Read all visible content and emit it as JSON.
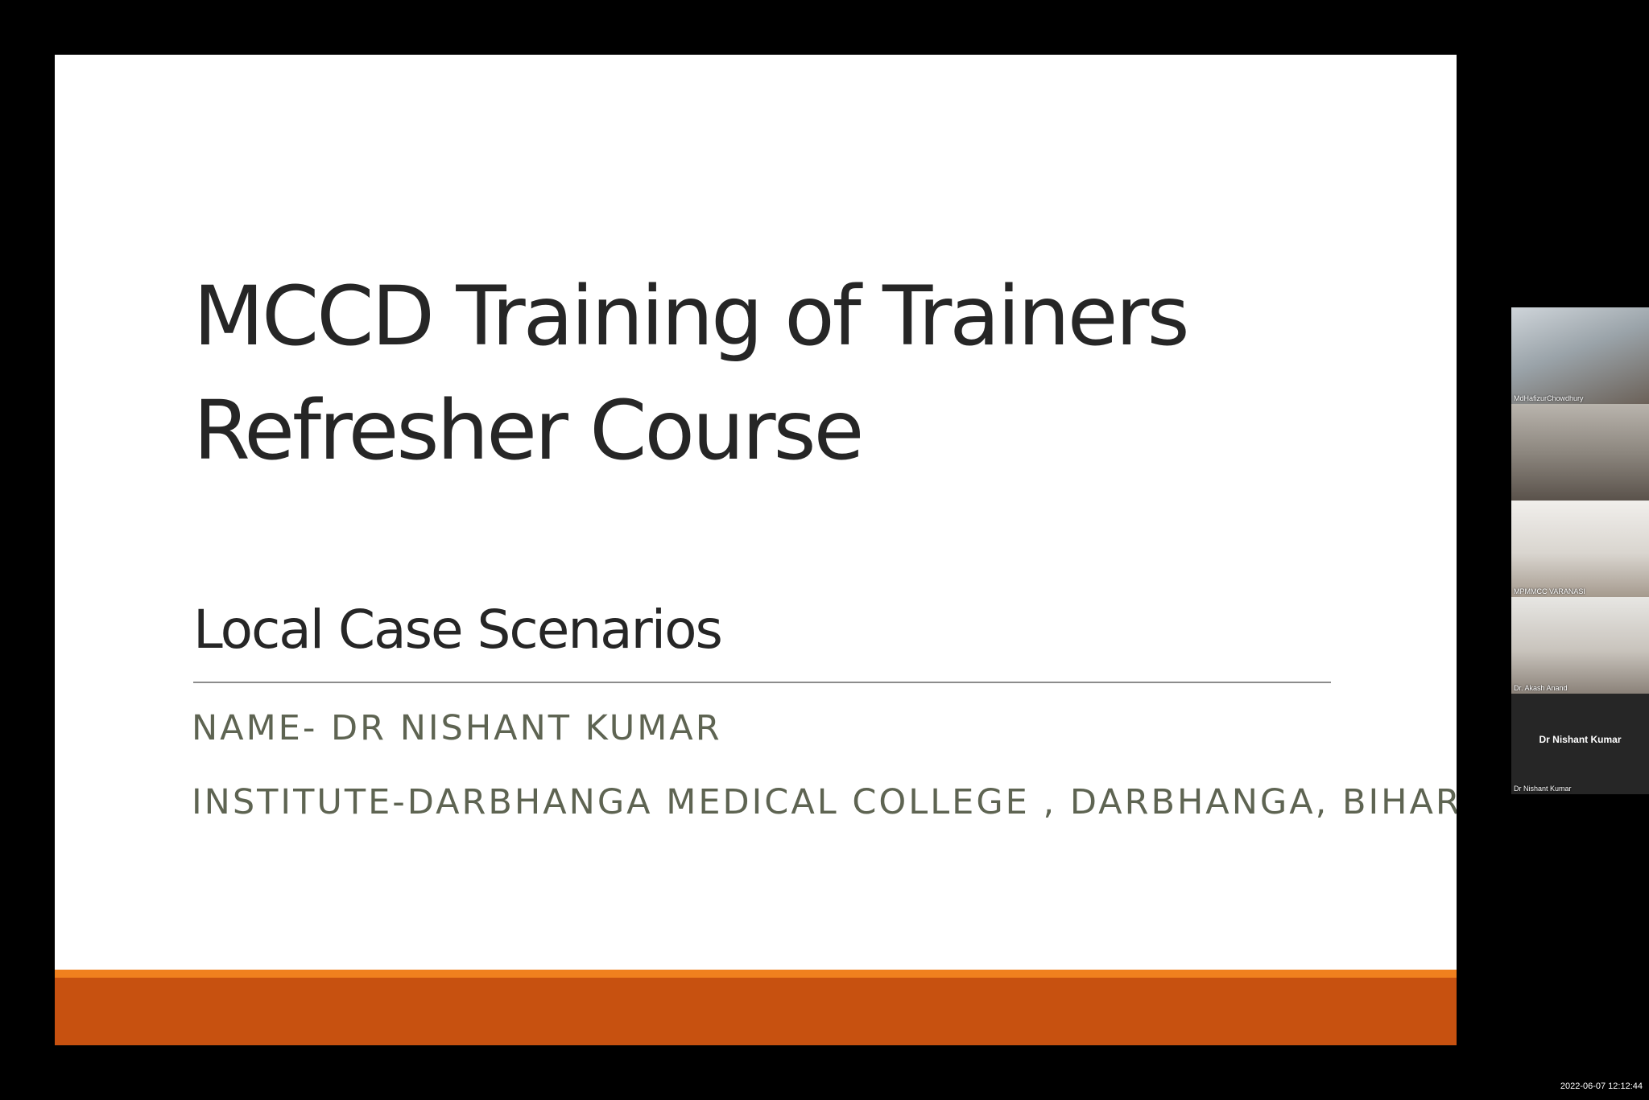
{
  "slide": {
    "title_line1": "MCCD Training of Trainers",
    "title_line2": "Refresher Course",
    "subtitle": "Local Case Scenarios",
    "name_line": "NAME- DR NISHANT KUMAR",
    "institute_line": "INSTITUTE-DARBHANGA MEDICAL COLLEGE , DARBHANGA, BIHAR",
    "colors": {
      "accent_orange": "#f0801e",
      "accent_rust": "#c75110",
      "title_text": "#262626",
      "detail_text": "#5e6452"
    }
  },
  "participants": [
    {
      "label": "MdHafizurChowdhury",
      "video": true
    },
    {
      "label": "",
      "video": true
    },
    {
      "label": "MPMMCC VARANASI",
      "video": true
    },
    {
      "label": "Dr. Akash Anand",
      "video": true
    },
    {
      "label": "Dr Nishant Kumar",
      "display_name": "Dr Nishant Kumar",
      "video": false
    }
  ],
  "timestamp": "2022-06-07 12:12:44"
}
